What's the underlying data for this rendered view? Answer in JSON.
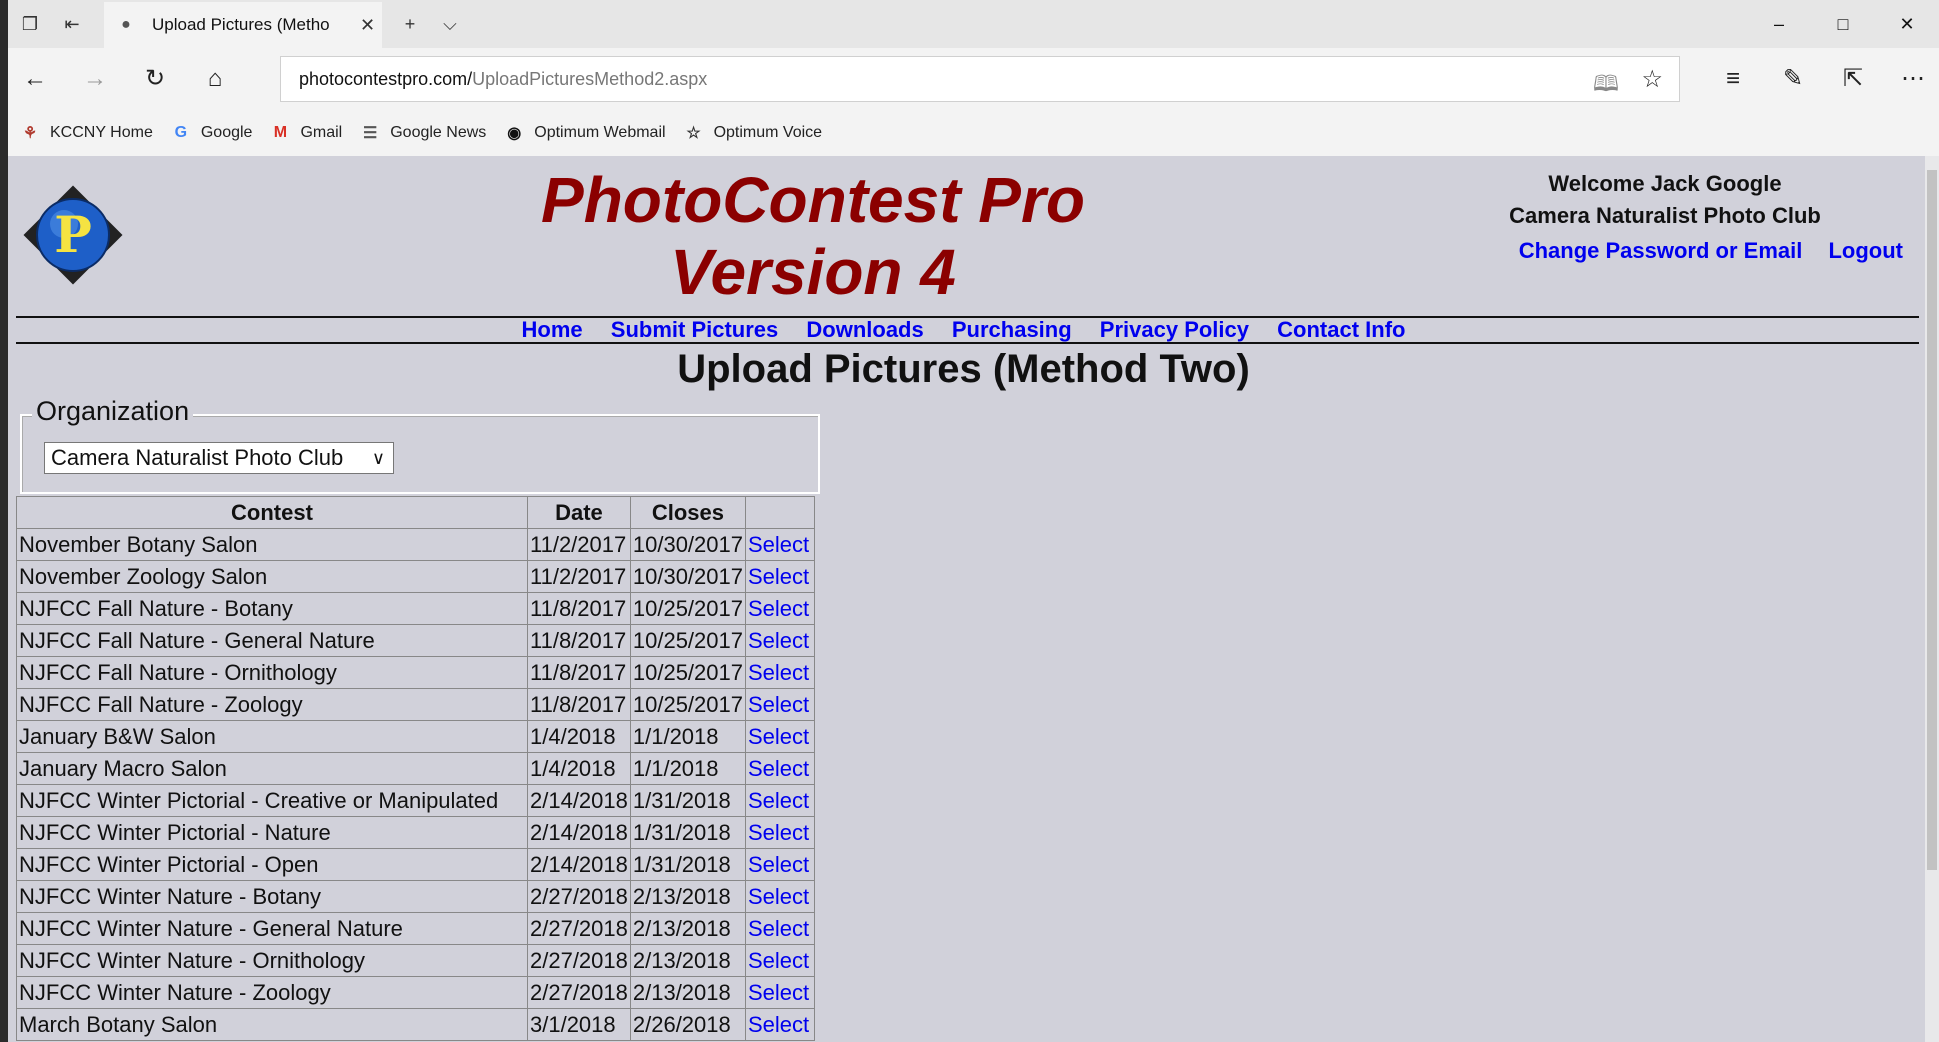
{
  "browser": {
    "tab_title": "Upload Pictures (Metho",
    "url_host": "photocontestpro.com/",
    "url_path": "UploadPicturesMethod2.aspx",
    "favorites": [
      {
        "label": "KCCNY Home",
        "icon": "kccny-icon"
      },
      {
        "label": "Google",
        "icon": "google-icon"
      },
      {
        "label": "Gmail",
        "icon": "gmail-icon"
      },
      {
        "label": "Google News",
        "icon": "google-news-icon"
      },
      {
        "label": "Optimum Webmail",
        "icon": "optimum-icon"
      },
      {
        "label": "Optimum Voice",
        "icon": "star-icon"
      }
    ]
  },
  "site": {
    "title_line1": "PhotoContest Pro",
    "title_line2": "Version 4",
    "welcome": "Welcome Jack Google",
    "club": "Camera Naturalist Photo Club",
    "change_password": "Change Password or Email",
    "logout": "Logout",
    "menu": [
      "Home",
      "Submit Pictures",
      "Downloads",
      "Purchasing",
      "Privacy Policy",
      "Contact Info"
    ]
  },
  "main": {
    "heading": "Upload Pictures (Method Two)",
    "org_legend": "Organization",
    "org_selected": "Camera Naturalist Photo Club",
    "table": {
      "headers": [
        "Contest",
        "Date",
        "Closes",
        ""
      ],
      "select_label": "Select",
      "rows": [
        [
          "November Botany Salon",
          "11/2/2017",
          "10/30/2017"
        ],
        [
          "November Zoology Salon",
          "11/2/2017",
          "10/30/2017"
        ],
        [
          "NJFCC Fall Nature - Botany",
          "11/8/2017",
          "10/25/2017"
        ],
        [
          "NJFCC Fall Nature - General Nature",
          "11/8/2017",
          "10/25/2017"
        ],
        [
          "NJFCC Fall Nature - Ornithology",
          "11/8/2017",
          "10/25/2017"
        ],
        [
          "NJFCC Fall Nature - Zoology",
          "11/8/2017",
          "10/25/2017"
        ],
        [
          "January B&W Salon",
          "1/4/2018",
          "1/1/2018"
        ],
        [
          "January Macro Salon",
          "1/4/2018",
          "1/1/2018"
        ],
        [
          "NJFCC Winter Pictorial - Creative or Manipulated",
          "2/14/2018",
          "1/31/2018"
        ],
        [
          "NJFCC Winter Pictorial - Nature",
          "2/14/2018",
          "1/31/2018"
        ],
        [
          "NJFCC Winter Pictorial - Open",
          "2/14/2018",
          "1/31/2018"
        ],
        [
          "NJFCC Winter Nature - Botany",
          "2/27/2018",
          "2/13/2018"
        ],
        [
          "NJFCC Winter Nature - General Nature",
          "2/27/2018",
          "2/13/2018"
        ],
        [
          "NJFCC Winter Nature - Ornithology",
          "2/27/2018",
          "2/13/2018"
        ],
        [
          "NJFCC Winter Nature - Zoology",
          "2/27/2018",
          "2/13/2018"
        ],
        [
          "March Botany Salon",
          "3/1/2018",
          "2/26/2018"
        ]
      ]
    }
  }
}
